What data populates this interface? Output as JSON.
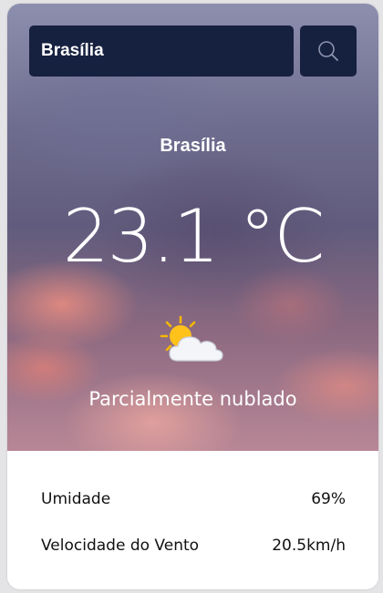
{
  "search": {
    "value": "Brasília",
    "button_icon": "search-icon"
  },
  "weather": {
    "city": "Brasília",
    "temperature": "23.1 °C",
    "condition_icon": "partly-cloudy-icon",
    "description": "Parcialmente nublado"
  },
  "details": {
    "humidity": {
      "label": "Umidade",
      "value": "69%"
    },
    "wind": {
      "label": "Velocidade do Vento",
      "value": "20.5km/h"
    }
  },
  "colors": {
    "search_bg": "#16203f",
    "text_light": "#ffffff",
    "text_dark": "#111111",
    "page_bg": "#e4e4e6"
  }
}
